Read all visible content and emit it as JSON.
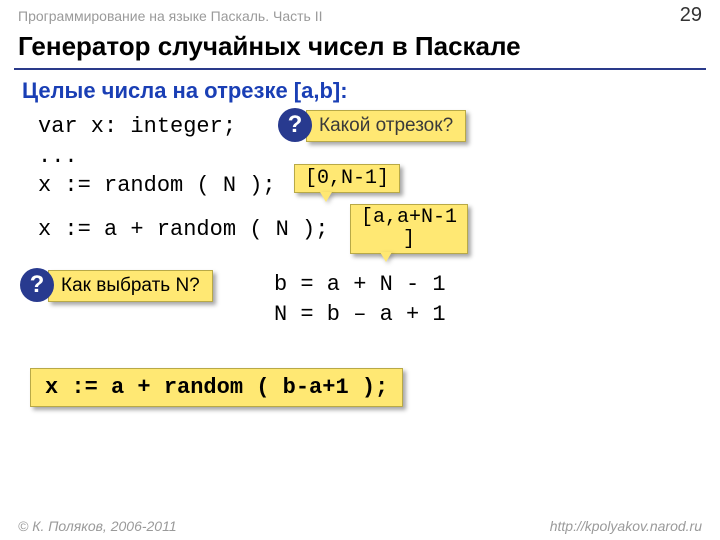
{
  "header": {
    "course": "Программирование на языке Паскаль. Часть II",
    "page": "29"
  },
  "title": "Генератор случайных чисел в Паскале",
  "subtitle": "Целые числа на отрезке [a,b]:",
  "code": {
    "line1": "var x: integer;",
    "line2": "...",
    "line3": "x := random ( N );",
    "line4": "x := a + random ( N );"
  },
  "callouts": {
    "which_segment": "Какой отрезок?",
    "how_choose_n": "Как выбрать N?"
  },
  "notes": {
    "range1": "[0,N-1]",
    "range2_l1": "[a,a+N-1",
    "range2_l2": "]"
  },
  "equations": {
    "eq1": "b = a + N - 1",
    "eq2": "N = b – a + 1"
  },
  "final_formula": "x := a + random ( b-a+1 );",
  "footer": {
    "copyright": "© К. Поляков, 2006-2011",
    "url": "http://kpolyakov.narod.ru"
  },
  "icons": {
    "question": "?"
  }
}
